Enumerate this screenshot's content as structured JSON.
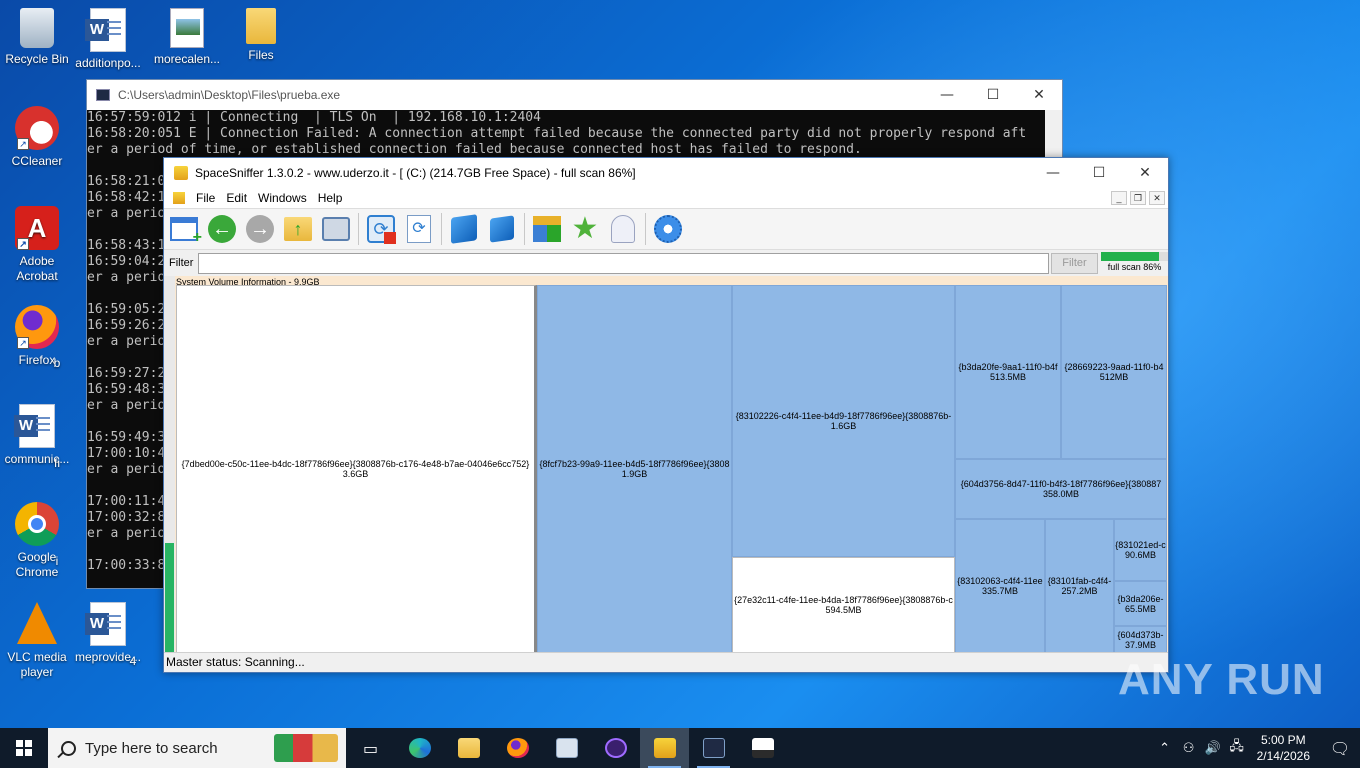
{
  "desktop": {
    "icons": [
      {
        "label": "Recycle Bin"
      },
      {
        "label": "additionpo..."
      },
      {
        "label": "morecalen..."
      },
      {
        "label": "Files"
      },
      {
        "label": "CCleaner"
      },
      {
        "label": "Adobe Acrobat"
      },
      {
        "label": "Firefox"
      },
      {
        "label": "communic..."
      },
      {
        "label": "Google Chrome"
      },
      {
        "label": "VLC media player"
      },
      {
        "label": "meprovide..."
      }
    ],
    "partial_labels": [
      "b",
      "fi",
      "i",
      "4"
    ],
    "watermark": "ANY RUN"
  },
  "console": {
    "title": "C:\\Users\\admin\\Desktop\\Files\\prueba.exe",
    "lines": [
      "16:57:59:012 i | Connecting  | TLS On  | 192.168.10.1:2404",
      "16:58:20:051 E | Connection Failed: A connection attempt failed because the connected party did not properly respond aft",
      "er a period of time, or established connection failed because connected host has failed to respond.",
      "",
      "16:58:21:0",
      "16:58:42:1",
      "er a perio",
      "",
      "16:58:43:1",
      "16:59:04:2",
      "er a perio",
      "",
      "16:59:05:2",
      "16:59:26:2",
      "er a perio",
      "",
      "16:59:27:2",
      "16:59:48:3",
      "er a perio",
      "",
      "16:59:49:3",
      "17:00:10:4",
      "er a perio",
      "",
      "17:00:11:4",
      "17:00:32:8",
      "er a perio",
      "",
      "17:00:33:8"
    ],
    "controls": {
      "minimize": "—",
      "maximize": "☐",
      "close": "✕"
    }
  },
  "spacesniffer": {
    "title": "SpaceSniffer 1.3.0.2 - www.uderzo.it - [ (C:) (214.7GB Free Space) - full scan 86%]",
    "controls": {
      "minimize": "—",
      "maximize": "☐",
      "close": "✕"
    },
    "menu": [
      "File",
      "Edit",
      "Windows",
      "Help"
    ],
    "mdi_controls": [
      "_",
      "❐",
      "✕"
    ],
    "filter_label": "Filter",
    "filter_value": "",
    "filter_button": "Filter",
    "scan_progress": 0.86,
    "scan_label": "full scan 86%",
    "map_label": "System Volume Information - 9.9GB",
    "tiles": [
      {
        "name": "{7dbed00e-c50c-11ee-b4dc-18f7786f96ee}{3808876b-c176-4e48-b7ae-04046e6cc752}",
        "size": "3.6GB"
      },
      {
        "name": "{8fcf7b23-99a9-11ee-b4d5-18f7786f96ee}{3808",
        "size": "1.9GB"
      },
      {
        "name": "{83102226-c4f4-11ee-b4d9-18f7786f96ee}{3808876b-",
        "size": "1.6GB"
      },
      {
        "name": "{27e32c11-c4fe-11ee-b4da-18f7786f96ee}{3808876b-c",
        "size": "594.5MB"
      },
      {
        "name": "{b3da20fe-9aa1-11f0-b4f",
        "size": "513.5MB"
      },
      {
        "name": "{28669223-9aad-11f0-b4",
        "size": "512MB"
      },
      {
        "name": "{604d3756-8d47-11f0-b4f3-18f7786f96ee}{380887",
        "size": "358.0MB"
      },
      {
        "name": "{83102063-c4f4-11ee",
        "size": "335.7MB"
      },
      {
        "name": "{83101fab-c4f4-",
        "size": "257.2MB"
      },
      {
        "name": "{831021ed-c",
        "size": "90.6MB"
      },
      {
        "name": "{b3da206e-",
        "size": "65.5MB"
      },
      {
        "name": "{604d373b-",
        "size": "37.9MB"
      }
    ],
    "status": "Master status: Scanning...",
    "toolbar_icons": [
      "new-view-icon",
      "back-icon",
      "forward-icon",
      "up-folder-icon",
      "home-icon",
      "refresh-icon",
      "rescan-icon",
      "zoom-in-cube-icon",
      "zoom-out-cube-icon",
      "blocks-icon",
      "star-icon",
      "ghost-icon",
      "settings-icon"
    ]
  },
  "taskbar": {
    "search_placeholder": "Type here to search",
    "time": "5:00 PM",
    "date": "2/14/2026"
  }
}
